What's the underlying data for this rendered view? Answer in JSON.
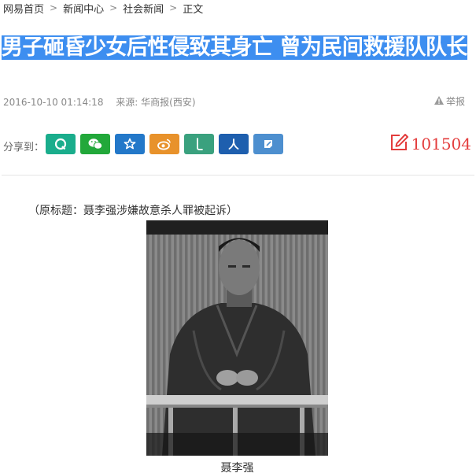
{
  "breadcrumb": {
    "items": [
      "网易首页",
      "新闻中心",
      "社会新闻",
      "正文"
    ],
    "separator": ">"
  },
  "article": {
    "title": "男子砸昏少女后性侵致其身亡 曾为民间救援队队长",
    "datetime": "2016-10-10 01:14:18",
    "source": "来源: 华商报(西安)",
    "report_label": "举报",
    "original_title": "（原标题：聂李强涉嫌故意杀人罪被起诉）",
    "photo_caption": "聂李强"
  },
  "share": {
    "label": "分享到：",
    "buttons": [
      {
        "name": "qzone",
        "color": "#1aad8c"
      },
      {
        "name": "wechat",
        "color": "#22a83a"
      },
      {
        "name": "favorite",
        "color": "#2378c9"
      },
      {
        "name": "weibo",
        "color": "#e8922b"
      },
      {
        "name": "lofter",
        "color": "#3aa17e"
      },
      {
        "name": "renren",
        "color": "#1e5fae"
      },
      {
        "name": "youdao-note",
        "color": "#4d8fcf"
      }
    ]
  },
  "comments": {
    "count": "101504",
    "color": "#e33c3c"
  },
  "colors": {
    "title_highlight": "#3d8ef0"
  }
}
